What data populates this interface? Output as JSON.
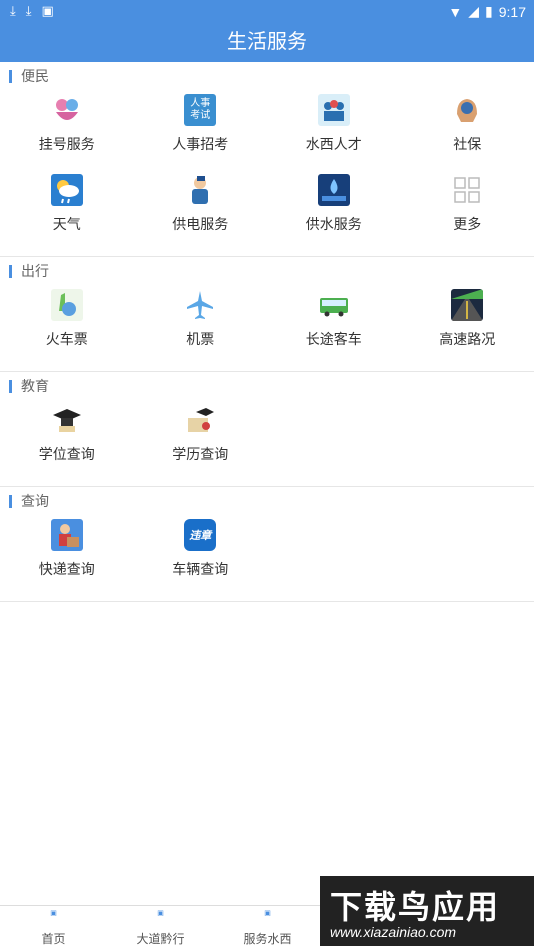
{
  "status_bar": {
    "time": "9:17"
  },
  "app_title": "生活服务",
  "sections": [
    {
      "title": "便民",
      "items": [
        {
          "label": "挂号服务",
          "icon": "hospital-icon"
        },
        {
          "label": "人事招考",
          "icon": "exam-icon",
          "icon_text": "人事考试"
        },
        {
          "label": "水西人才",
          "icon": "talent-icon"
        },
        {
          "label": "社保",
          "icon": "social-security-icon"
        },
        {
          "label": "天气",
          "icon": "weather-icon"
        },
        {
          "label": "供电服务",
          "icon": "power-icon"
        },
        {
          "label": "供水服务",
          "icon": "water-icon"
        },
        {
          "label": "更多",
          "icon": "more-grid-icon"
        }
      ]
    },
    {
      "title": "出行",
      "items": [
        {
          "label": "火车票",
          "icon": "train-icon"
        },
        {
          "label": "机票",
          "icon": "plane-icon"
        },
        {
          "label": "长途客车",
          "icon": "bus-icon"
        },
        {
          "label": "高速路况",
          "icon": "highway-icon"
        }
      ]
    },
    {
      "title": "教育",
      "items": [
        {
          "label": "学位查询",
          "icon": "graduation-cap-icon"
        },
        {
          "label": "学历查询",
          "icon": "diploma-icon"
        }
      ]
    },
    {
      "title": "查询",
      "items": [
        {
          "label": "快递查询",
          "icon": "courier-icon"
        },
        {
          "label": "车辆查询",
          "icon": "vehicle-icon",
          "icon_text": "违章"
        }
      ]
    }
  ],
  "bottom_nav": [
    {
      "label": "首页"
    },
    {
      "label": "大道黔行"
    },
    {
      "label": "服务水西"
    }
  ],
  "watermark": {
    "title": "下载鸟应用",
    "url": "www.xiazainiao.com"
  }
}
